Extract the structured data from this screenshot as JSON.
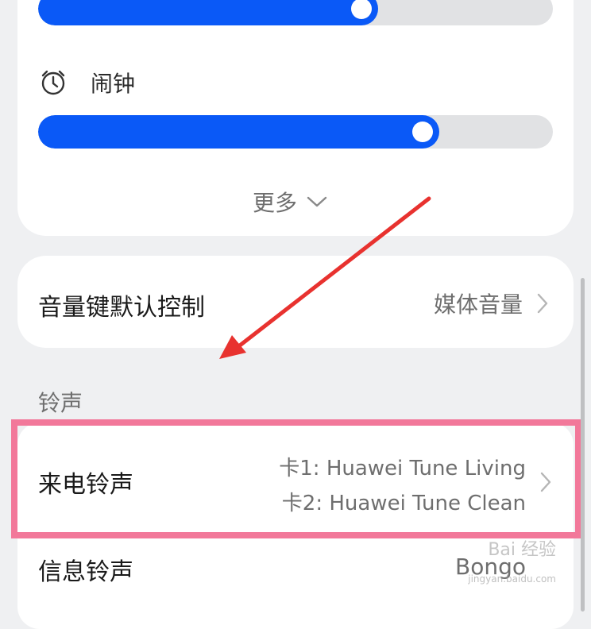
{
  "volume": {
    "media_slider": {
      "level_percent": 66
    },
    "alarm": {
      "label": "闹钟",
      "icon": "alarm-clock-icon",
      "level_percent": 78
    },
    "more_label": "更多"
  },
  "volume_key": {
    "label": "音量键默认控制",
    "value": "媒体音量"
  },
  "ringtones": {
    "section_label": "铃声",
    "incoming": {
      "label": "来电铃声",
      "sim1": "卡1: Huawei Tune Living",
      "sim2": "卡2: Huawei Tune Clean"
    },
    "message": {
      "label": "信息铃声",
      "value": "Bongo"
    }
  },
  "watermark": {
    "text": "Bai 经验",
    "url": "jingyan.baidu.com"
  },
  "colors": {
    "accent": "#0a59f7",
    "highlight": "#f2789a",
    "arrow": "#e8322f"
  }
}
